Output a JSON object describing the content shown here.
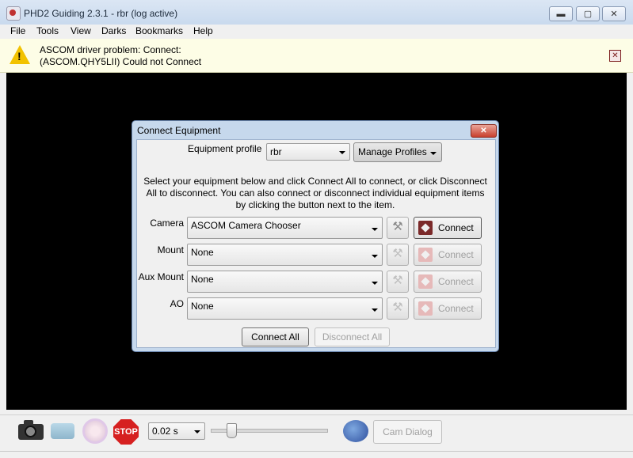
{
  "window": {
    "title": "PHD2 Guiding 2.3.1 - rbr (log active)",
    "minimize_glyph": "▬",
    "maximize_glyph": "▢",
    "close_glyph": "✕"
  },
  "menu": [
    "File",
    "Tools",
    "View",
    "Darks",
    "Bookmarks",
    "Help"
  ],
  "infobar": {
    "line1": "ASCOM driver problem: Connect:",
    "line2": "(ASCOM.QHY5LII) Could not Connect",
    "close_glyph": "✕"
  },
  "dialog": {
    "title": "Connect Equipment",
    "close_glyph": "✕",
    "profile_label": "Equipment profile",
    "profile_value": "rbr",
    "manage_profiles_label": "Manage Profiles",
    "instructions": [
      "Select your equipment below and click Connect All to connect, or click Disconnect",
      "All to disconnect. You can also connect or disconnect individual equipment items",
      "by clicking the button next to the item."
    ],
    "rows": [
      {
        "label": "Camera",
        "value": "ASCOM Camera Chooser",
        "button": "Connect",
        "enabled": true
      },
      {
        "label": "Mount",
        "value": "None",
        "button": "Connect",
        "enabled": false
      },
      {
        "label": "Aux Mount",
        "value": "None",
        "button": "Connect",
        "enabled": false
      },
      {
        "label": "AO",
        "value": "None",
        "button": "Connect",
        "enabled": false
      }
    ],
    "connect_all_label": "Connect All",
    "disconnect_all_label": "Disconnect All"
  },
  "toolbar": {
    "stop_label": "STOP",
    "exposure_value": "0.02 s",
    "exposure_level": 0.15,
    "cam_dialog_label": "Cam Dialog"
  },
  "icons": {
    "app": "phd2-app-icon",
    "warning": "warning-icon",
    "camera": "camera-icon",
    "loop": "loop-icon",
    "guide": "guide-icon",
    "stop": "stop-icon",
    "brain": "brain-icon",
    "setup": "wrench-icon",
    "connect": "plug-icon"
  },
  "colors": {
    "infobar_bg": "#fdfde6",
    "dialog_frame": "#c6d8ec",
    "canvas_bg": "#000000",
    "stop_red": "#d62020"
  }
}
